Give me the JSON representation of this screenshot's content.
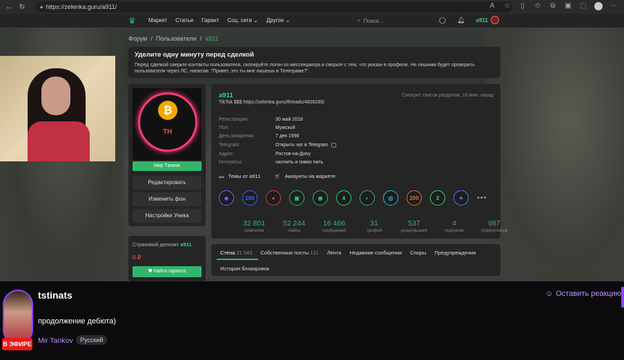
{
  "browser": {
    "url": "https://zelenka.guru/a911/"
  },
  "nav": {
    "items": [
      "Маркет",
      "Статьи",
      "Гарант",
      "Соц. сети ⌄",
      "Другое ⌄"
    ],
    "search_placeholder": "Поиск...",
    "username": "a911"
  },
  "breadcrumb": {
    "forum": "Форум",
    "users": "Пользователи",
    "current": "a911"
  },
  "warning": {
    "title": "Уделите одну минуту перед сделкой",
    "text": "Перед сделкой сверьте контакты пользователя, скопируйте логин из мессенджера и сверьте с тем, что указан в профиле. Не лишним будет проверить пользователя через ЛС, написав: \"Привет, это ты мне пишешь в Телеграме?\"."
  },
  "left": {
    "avatar_tag": "TH",
    "user_title": "Мир Танков",
    "buttons": [
      "Редактировать",
      "Изменить фон",
      "Настройки Уника"
    ],
    "deposit_label": "Страховой депозит",
    "deposit_user": "a911",
    "deposit_amount": "0 ₽",
    "guarant_label": "Найти гаранта"
  },
  "profile": {
    "name": "a911",
    "status": "TikTok $$$ https://zelenka.guru/threads/4826265/",
    "last_seen": "Смотрит список разделов, 16 мин. назад",
    "info": [
      {
        "k": "Регистрация:",
        "v": "30 май 2018"
      },
      {
        "k": "Пол:",
        "v": "Мужской"
      },
      {
        "k": "День рождения:",
        "v": "7 дек 1996"
      },
      {
        "k": "Telegram:",
        "v": "Открыть чат в Telegram"
      },
      {
        "k": "Адрес:",
        "v": "Ростов-на-Дону"
      },
      {
        "k": "Интересы:",
        "v": "чиллить и пивко пить"
      }
    ],
    "link_threads": "Темы от a911",
    "link_market": "Аккаунты на маркете",
    "trophy_colors": [
      "#7c5cff",
      "#3a64ff",
      "#d04050",
      "#31b66b",
      "#31b66b",
      "#31d77a",
      "#31b66b",
      "#2bbbe0",
      "#e0703a",
      "#31d77a",
      "#5a7aff"
    ],
    "trophy_glyphs": [
      "◆",
      "100",
      "●",
      "▣",
      "◉",
      "4",
      "◐",
      "◎",
      "200",
      "3",
      "✦"
    ],
    "more": "•••",
    "stats": [
      {
        "n": "32 801",
        "l": "симпатии"
      },
      {
        "n": "52 244",
        "l": "лайка"
      },
      {
        "n": "16 466",
        "l": "сообщений"
      },
      {
        "n": "31",
        "l": "трофей"
      },
      {
        "n": "537",
        "l": "розыгрышей"
      },
      {
        "n": "4",
        "l": "подписки"
      },
      {
        "n": "987",
        "l": "подписчиков"
      }
    ]
  },
  "tabs": {
    "wall": "Стена",
    "wall_count": "21 043",
    "own": "Собственные посты",
    "own_count": "121",
    "feed": "Лента",
    "recent": "Недавние сообщения",
    "disputes": "Споры",
    "warnings": "Предупреждения",
    "bans": "История блокировок"
  },
  "stream": {
    "channel": "tstinats",
    "title": "продолжение дебюта)",
    "category": "Mir Tankov",
    "language": "Русский",
    "live": "В ЭФИРЕ",
    "react": "Оставить реакцию"
  }
}
